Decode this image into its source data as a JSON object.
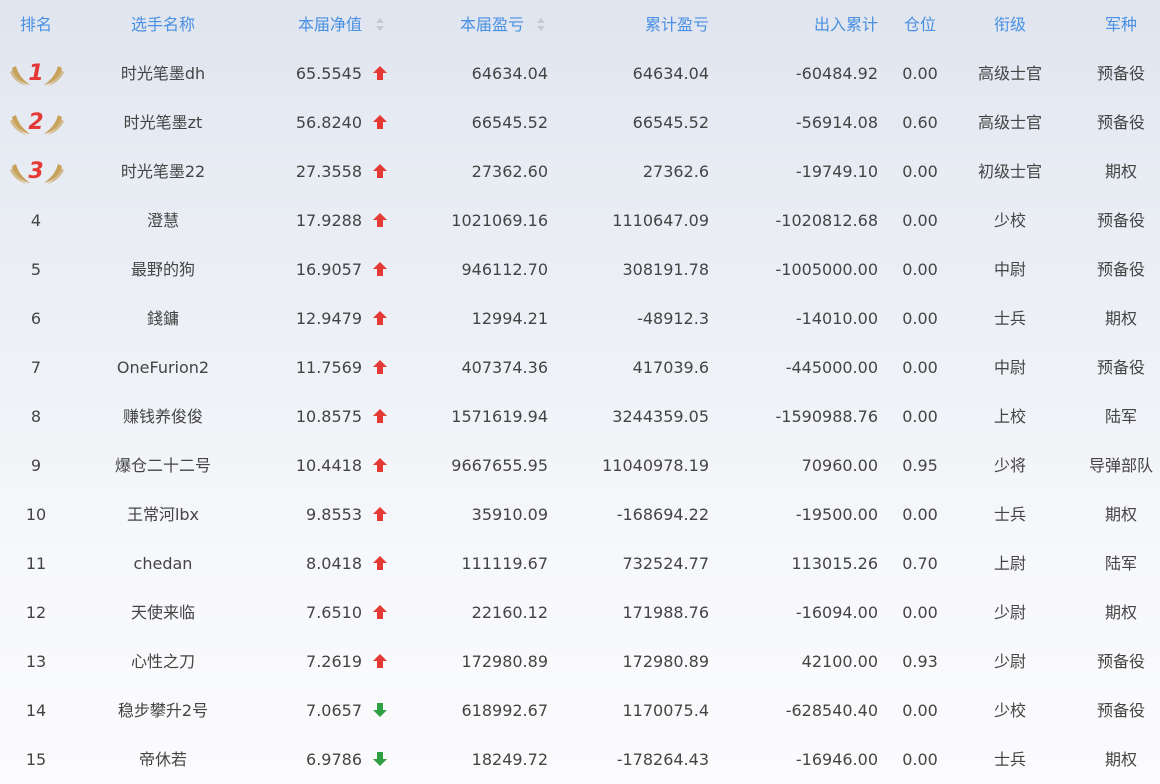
{
  "header": {
    "rank": "排名",
    "name": "选手名称",
    "nav": "本届净值",
    "current_pnl": "本届盈亏",
    "cumulative_pnl": "累计盈亏",
    "in_out": "出入累计",
    "position": "仓位",
    "title": "衔级",
    "arm": "军种"
  },
  "colors": {
    "header_text": "#4a90e2",
    "arrow_up": "#e53935",
    "arrow_down": "#2ea043",
    "medal_number": "#e53935",
    "medal_wing": "#c49a4a"
  },
  "rows": [
    {
      "rank": "1",
      "name": "时光笔墨dh",
      "nav": "65.5545",
      "trend": "up",
      "cur": "64634.04",
      "cum": "64634.04",
      "io": "-60484.92",
      "pos": "0.00",
      "title": "高级士官",
      "arm": "预备役"
    },
    {
      "rank": "2",
      "name": "时光笔墨zt",
      "nav": "56.8240",
      "trend": "up",
      "cur": "66545.52",
      "cum": "66545.52",
      "io": "-56914.08",
      "pos": "0.60",
      "title": "高级士官",
      "arm": "预备役"
    },
    {
      "rank": "3",
      "name": "时光笔墨22",
      "nav": "27.3558",
      "trend": "up",
      "cur": "27362.60",
      "cum": "27362.6",
      "io": "-19749.10",
      "pos": "0.00",
      "title": "初级士官",
      "arm": "期权"
    },
    {
      "rank": "4",
      "name": "澄慧",
      "nav": "17.9288",
      "trend": "up",
      "cur": "1021069.16",
      "cum": "1110647.09",
      "io": "-1020812.68",
      "pos": "0.00",
      "title": "少校",
      "arm": "预备役"
    },
    {
      "rank": "5",
      "name": "最野的狗",
      "nav": "16.9057",
      "trend": "up",
      "cur": "946112.70",
      "cum": "308191.78",
      "io": "-1005000.00",
      "pos": "0.00",
      "title": "中尉",
      "arm": "预备役"
    },
    {
      "rank": "6",
      "name": "錢鏞",
      "nav": "12.9479",
      "trend": "up",
      "cur": "12994.21",
      "cum": "-48912.3",
      "io": "-14010.00",
      "pos": "0.00",
      "title": "士兵",
      "arm": "期权"
    },
    {
      "rank": "7",
      "name": "OneFurion2",
      "nav": "11.7569",
      "trend": "up",
      "cur": "407374.36",
      "cum": "417039.6",
      "io": "-445000.00",
      "pos": "0.00",
      "title": "中尉",
      "arm": "预备役"
    },
    {
      "rank": "8",
      "name": "赚钱养俊俊",
      "nav": "10.8575",
      "trend": "up",
      "cur": "1571619.94",
      "cum": "3244359.05",
      "io": "-1590988.76",
      "pos": "0.00",
      "title": "上校",
      "arm": "陆军"
    },
    {
      "rank": "9",
      "name": "爆仓二十二号",
      "nav": "10.4418",
      "trend": "up",
      "cur": "9667655.95",
      "cum": "11040978.19",
      "io": "70960.00",
      "pos": "0.95",
      "title": "少将",
      "arm": "导弹部队"
    },
    {
      "rank": "10",
      "name": "王常河lbx",
      "nav": "9.8553",
      "trend": "up",
      "cur": "35910.09",
      "cum": "-168694.22",
      "io": "-19500.00",
      "pos": "0.00",
      "title": "士兵",
      "arm": "期权"
    },
    {
      "rank": "11",
      "name": "chedan",
      "nav": "8.0418",
      "trend": "up",
      "cur": "111119.67",
      "cum": "732524.77",
      "io": "113015.26",
      "pos": "0.70",
      "title": "上尉",
      "arm": "陆军"
    },
    {
      "rank": "12",
      "name": "天使来临",
      "nav": "7.6510",
      "trend": "up",
      "cur": "22160.12",
      "cum": "171988.76",
      "io": "-16094.00",
      "pos": "0.00",
      "title": "少尉",
      "arm": "期权"
    },
    {
      "rank": "13",
      "name": "心性之刀",
      "nav": "7.2619",
      "trend": "up",
      "cur": "172980.89",
      "cum": "172980.89",
      "io": "42100.00",
      "pos": "0.93",
      "title": "少尉",
      "arm": "预备役"
    },
    {
      "rank": "14",
      "name": "稳步攀升2号",
      "nav": "7.0657",
      "trend": "down",
      "cur": "618992.67",
      "cum": "1170075.4",
      "io": "-628540.40",
      "pos": "0.00",
      "title": "少校",
      "arm": "预备役"
    },
    {
      "rank": "15",
      "name": "帝休若",
      "nav": "6.9786",
      "trend": "down",
      "cur": "18249.72",
      "cum": "-178264.43",
      "io": "-16946.00",
      "pos": "0.00",
      "title": "士兵",
      "arm": "期权"
    }
  ]
}
